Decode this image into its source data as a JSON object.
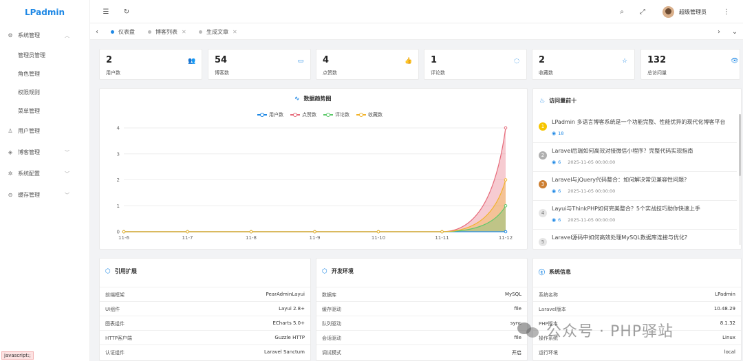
{
  "app": {
    "logo": "LPadmin"
  },
  "sidebar": {
    "items": [
      {
        "label": "系统管理",
        "icon": "gear-icon",
        "expanded": true,
        "children": [
          "管理员管理",
          "角色管理",
          "权限规则",
          "菜单管理"
        ]
      },
      {
        "label": "用户管理",
        "icon": "user-icon"
      },
      {
        "label": "博客管理",
        "icon": "layers-icon",
        "has_children": true
      },
      {
        "label": "系统配置",
        "icon": "settings-icon",
        "has_children": true
      },
      {
        "label": "缓存管理",
        "icon": "refresh-circle-icon",
        "has_children": true
      }
    ],
    "status_tip": "javascript:;"
  },
  "topbar": {
    "user_name": "超级管理员",
    "icons": [
      "menu-fold-icon",
      "refresh-icon",
      "search-icon",
      "fullscreen-icon",
      "more-icon"
    ]
  },
  "tabs": [
    {
      "label": "仪表盘",
      "active": true
    },
    {
      "label": "博客列表",
      "active": false
    },
    {
      "label": "生成文章",
      "active": false
    }
  ],
  "stats": [
    {
      "value": "2",
      "label": "用户数",
      "icon": "users-icon"
    },
    {
      "value": "54",
      "label": "博客数",
      "icon": "document-icon"
    },
    {
      "value": "4",
      "label": "点赞数",
      "icon": "thumb-up-icon"
    },
    {
      "value": "1",
      "label": "评论数",
      "icon": "comment-icon"
    },
    {
      "value": "2",
      "label": "收藏数",
      "icon": "star-icon"
    },
    {
      "value": "132",
      "label": "总访问量",
      "icon": "eye-icon"
    }
  ],
  "trend": {
    "title": "数据趋势图"
  },
  "chart_data": {
    "type": "line",
    "categories": [
      "11-6",
      "11-7",
      "11-8",
      "11-9",
      "11-10",
      "11-11",
      "11-12"
    ],
    "series": [
      {
        "name": "用户数",
        "values": [
          0,
          0,
          0,
          0,
          0,
          0,
          0
        ],
        "color": "#1e88e5"
      },
      {
        "name": "点赞数",
        "values": [
          0,
          0,
          0,
          0,
          0,
          0,
          4
        ],
        "color": "#e66a7a"
      },
      {
        "name": "评论数",
        "values": [
          0,
          0,
          0,
          0,
          0,
          0,
          1
        ],
        "color": "#5cc96a"
      },
      {
        "name": "收藏数",
        "values": [
          0,
          0,
          0,
          0,
          0,
          0,
          2
        ],
        "color": "#f2b32a"
      }
    ],
    "ylim": [
      0,
      4
    ],
    "yticks": [
      "0",
      "1",
      "2",
      "3",
      "4"
    ],
    "grid": true,
    "legend": "top-center",
    "smooth": true,
    "area": true
  },
  "top_ten": {
    "title": "访问量前十",
    "items": [
      {
        "rank": "1",
        "title": "LPadmin 多语言博客系统是一个功能完整、性能优异的现代化博客平台",
        "views": "18",
        "date": ""
      },
      {
        "rank": "2",
        "title": "Laravel后端如何高效对接微信小程序？完整代码实现指南",
        "views": "6",
        "date": "2025-11-05 00:00:00"
      },
      {
        "rank": "3",
        "title": "Laravel与jQuery代码整合：如何解决常见兼容性问题?",
        "views": "6",
        "date": "2025-11-05 00:00:00"
      },
      {
        "rank": "4",
        "title": "Layui与ThinkPHP如何完美整合？5个实战技巧助你快速上手",
        "views": "6",
        "date": "2025-11-05 00:00:00"
      },
      {
        "rank": "5",
        "title": "Laravel源码中如何高效处理MySQL数据库连接与优化?",
        "views": "",
        "date": ""
      }
    ]
  },
  "extensions": {
    "title": "引用扩展",
    "rows": [
      {
        "k": "前端框架",
        "v": "PearAdminLayui"
      },
      {
        "k": "UI组件",
        "v": "Layui 2.8+"
      },
      {
        "k": "图表组件",
        "v": "ECharts 5.0+"
      },
      {
        "k": "HTTP客户端",
        "v": "Guzzle HTTP"
      },
      {
        "k": "认证组件",
        "v": "Laravel Sanctum"
      }
    ]
  },
  "devenv": {
    "title": "开发环境",
    "rows": [
      {
        "k": "数据库",
        "v": "MySQL"
      },
      {
        "k": "缓存驱动",
        "v": "file"
      },
      {
        "k": "队列驱动",
        "v": "sync"
      },
      {
        "k": "会话驱动",
        "v": "file"
      },
      {
        "k": "调试模式",
        "v": "开启"
      }
    ]
  },
  "sysinfo": {
    "title": "系统信息",
    "rows": [
      {
        "k": "系统名称",
        "v": "LPadmin"
      },
      {
        "k": "Laravel版本",
        "v": "10.48.29"
      },
      {
        "k": "PHP版本",
        "v": "8.1.32"
      },
      {
        "k": "操作系统",
        "v": "Linux"
      },
      {
        "k": "运行环境",
        "v": "local"
      }
    ]
  },
  "watermark": {
    "text": "公众号 · PHP驿站"
  }
}
